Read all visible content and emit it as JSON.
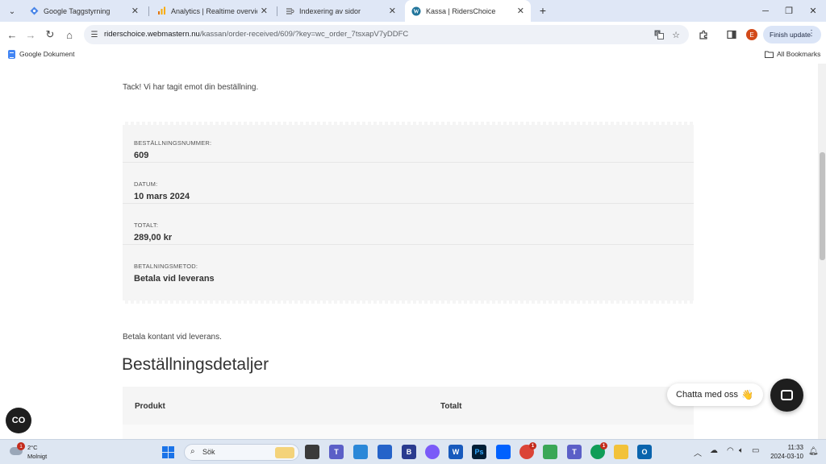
{
  "browser": {
    "tabs": [
      {
        "label": "Google Taggstyrning",
        "icon": "tag-manager-icon",
        "active": false
      },
      {
        "label": "Analytics | Realtime overview",
        "icon": "analytics-icon",
        "active": false
      },
      {
        "label": "Indexering av sidor",
        "icon": "search-console-icon",
        "active": false
      },
      {
        "label": "Kassa | RidersChoice",
        "icon": "wordpress-icon",
        "active": true
      }
    ],
    "url": {
      "host": "riderschoice.webmastern.nu",
      "path": "/kassan/order-received/609/?key=wc_order_7tsxapV7yDDFC"
    },
    "profile_initial": "E",
    "finish_update_label": "Finish update",
    "bookmarks": {
      "left": "Google Dokument",
      "right": "All Bookmarks"
    }
  },
  "page": {
    "thanks_text": "Tack! Vi har tagit emot din beställning.",
    "order_overview": [
      {
        "label": "BESTÄLLNINGSNUMMER:",
        "value": "609"
      },
      {
        "label": "DATUM:",
        "value": "10 mars 2024"
      },
      {
        "label": "TOTALT:",
        "value": "289,00 kr"
      },
      {
        "label": "BETALNINGSMETOD:",
        "value": "Betala vid leverans"
      }
    ],
    "payment_note": "Betala kontant vid leverans.",
    "details_title": "Beställningsdetaljer",
    "details_table": {
      "headers": [
        "Produkt",
        "Totalt"
      ]
    },
    "cc_button_label": "CO",
    "chat_bubble_text": "Chatta med oss",
    "chat_bubble_emoji": "👋"
  },
  "taskbar": {
    "weather": {
      "temp": "2°C",
      "condition": "Molnigt",
      "badge": "1"
    },
    "search_placeholder": "Sök",
    "apps": [
      {
        "name": "task-view",
        "label": "",
        "color": "#3a3a3a"
      },
      {
        "name": "teams",
        "label": "T",
        "color": "#5b5fc7"
      },
      {
        "name": "notepad",
        "label": "",
        "color": "#2b88d8"
      },
      {
        "name": "store",
        "label": "",
        "color": "#2563c9"
      },
      {
        "name": "b-app",
        "label": "B",
        "color": "#2a3b8f"
      },
      {
        "name": "copilot",
        "label": "",
        "color": "#7a5af8"
      },
      {
        "name": "word",
        "label": "W",
        "color": "#185abd"
      },
      {
        "name": "photoshop",
        "label": "Ps",
        "color": "#001e36"
      },
      {
        "name": "dropbox",
        "label": "",
        "color": "#0061fe"
      },
      {
        "name": "chrome",
        "label": "",
        "color": "#db4437",
        "badge": "1"
      },
      {
        "name": "photos",
        "label": "",
        "color": "#3aa757"
      },
      {
        "name": "teams-2",
        "label": "T",
        "color": "#5b5fc7"
      },
      {
        "name": "chrome-2",
        "label": "",
        "color": "#0f9d58",
        "badge": "1"
      },
      {
        "name": "explorer",
        "label": "",
        "color": "#f2c23a"
      },
      {
        "name": "outlook",
        "label": "O",
        "color": "#0a64ad"
      }
    ],
    "time": "11:33",
    "date": "2024-03-10"
  }
}
